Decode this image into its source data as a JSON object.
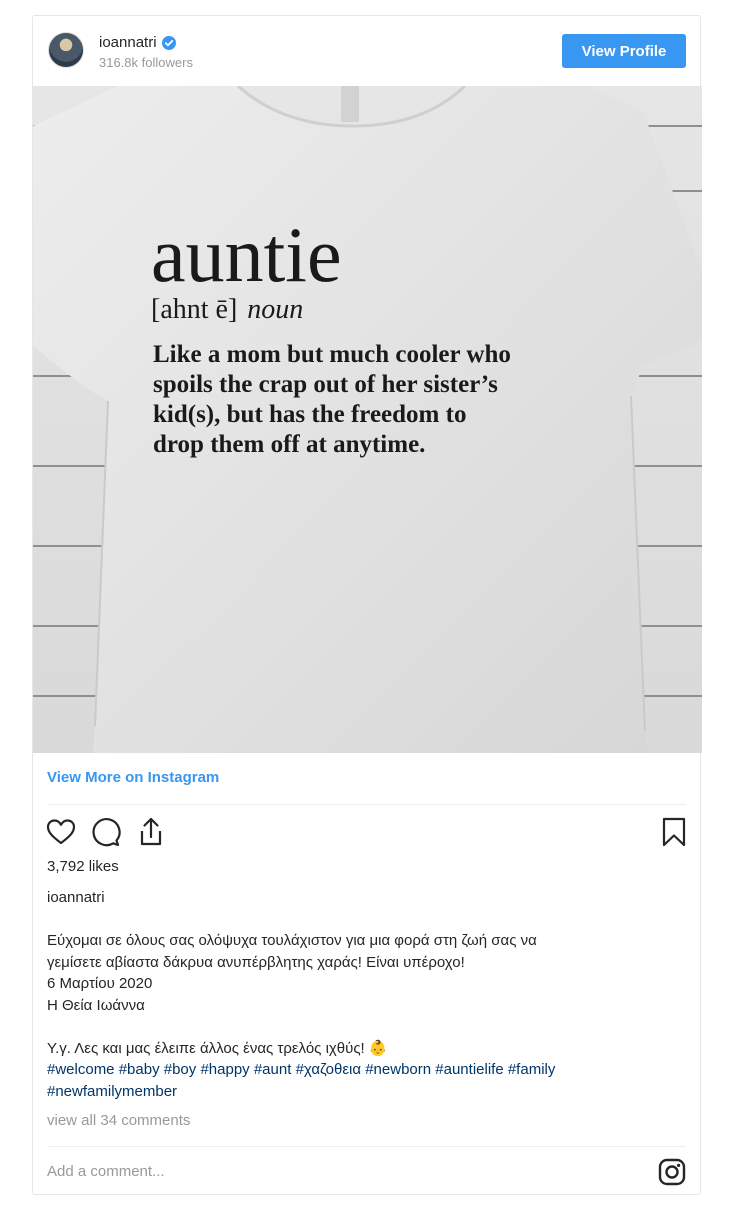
{
  "header": {
    "username": "ioannatri",
    "followers": "316.8k followers",
    "view_profile_label": "View Profile"
  },
  "photo": {
    "word": "auntie",
    "pronunciation": "[ahnt ē]",
    "part_of_speech": "noun",
    "definition_lines": [
      "Like a mom but much cooler who",
      "spoils the crap out of her sister’s",
      "kid(s), but has the freedom to",
      "drop them off at anytime."
    ]
  },
  "view_more_label": "View More on Instagram",
  "actions": {
    "icons": [
      "heart-icon",
      "comment-icon",
      "share-icon",
      "bookmark-icon"
    ]
  },
  "likes": "3,792 likes",
  "owner": "ioannatri",
  "caption": {
    "lines": [
      "Εύχομαι σε όλους σας ολόψυχα τουλάχιστον για μια φορά στη ζωή σας να",
      "γεμίσετε αβίαστα δάκρυα ανυπέρβλητης χαράς! Είναι υπέροχο!",
      "6 Μαρτίου 2020",
      "Η Θεία Ιωάννα",
      "",
      "Υ.γ. Λες και μας έλειπε άλλος ένας τρελός ιχθύς! 👶"
    ],
    "hashtags_line1": [
      "#welcome",
      "#baby",
      "#boy",
      "#happy",
      "#aunt",
      "#χαζοθεια",
      "#newborn",
      "#auntielife",
      "#family"
    ],
    "hashtags_line2": [
      "#newfamilymember"
    ]
  },
  "view_comments": "view all 34 comments",
  "comment_placeholder": "Add a comment...",
  "colors": {
    "accent": "#3897f0",
    "hashtag": "#003569",
    "muted": "#999999"
  }
}
